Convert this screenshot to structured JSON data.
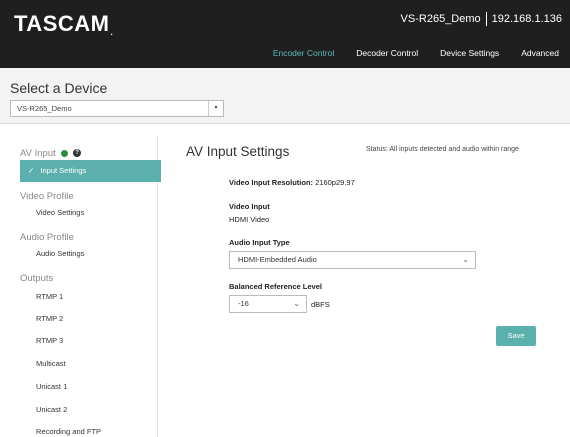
{
  "header": {
    "logo": "TASCAM",
    "logo_mark": ".",
    "device_name": "VS-R265_Demo",
    "ip_address": "192.168.1.136",
    "nav": [
      "Encoder Control",
      "Decoder Control",
      "Device Settings",
      "Advanced"
    ],
    "active_nav": "Encoder Control",
    "accent_color": "#5bbcb8"
  },
  "device_section": {
    "title": "Select a Device",
    "selected_device": "VS-R265_Demo"
  },
  "sidebar": {
    "av_input": {
      "heading": "AV Input",
      "status_color": "#2e8b3e",
      "help_icon": "?",
      "active_item": "Input Settings"
    },
    "video_profile": {
      "heading": "Video Profile",
      "item": "Video Settings"
    },
    "audio_profile": {
      "heading": "Audio Profile",
      "item": "Audio Settings"
    },
    "outputs": {
      "heading": "Outputs",
      "items": [
        "RTMP 1",
        "RTMP 2",
        "RTMP 3",
        "Multicast",
        "Unicast 1",
        "Unicast 2",
        "Recording and FTP"
      ]
    }
  },
  "main": {
    "title": "AV Input Settings",
    "status": "Status: All inputs detected and audio within range",
    "video_resolution_label": "Video Input Resolution:",
    "video_resolution_value": "2160p29.97",
    "video_input_label": "Video Input",
    "video_input_value": "HDMI Video",
    "audio_input_type_label": "Audio Input Type",
    "audio_input_type_value": "HDMI-Embedded Audio",
    "reference_level_label": "Balanced Reference Level",
    "reference_level_value": "-16",
    "reference_level_unit": "dBFS",
    "save_label": "Save"
  }
}
